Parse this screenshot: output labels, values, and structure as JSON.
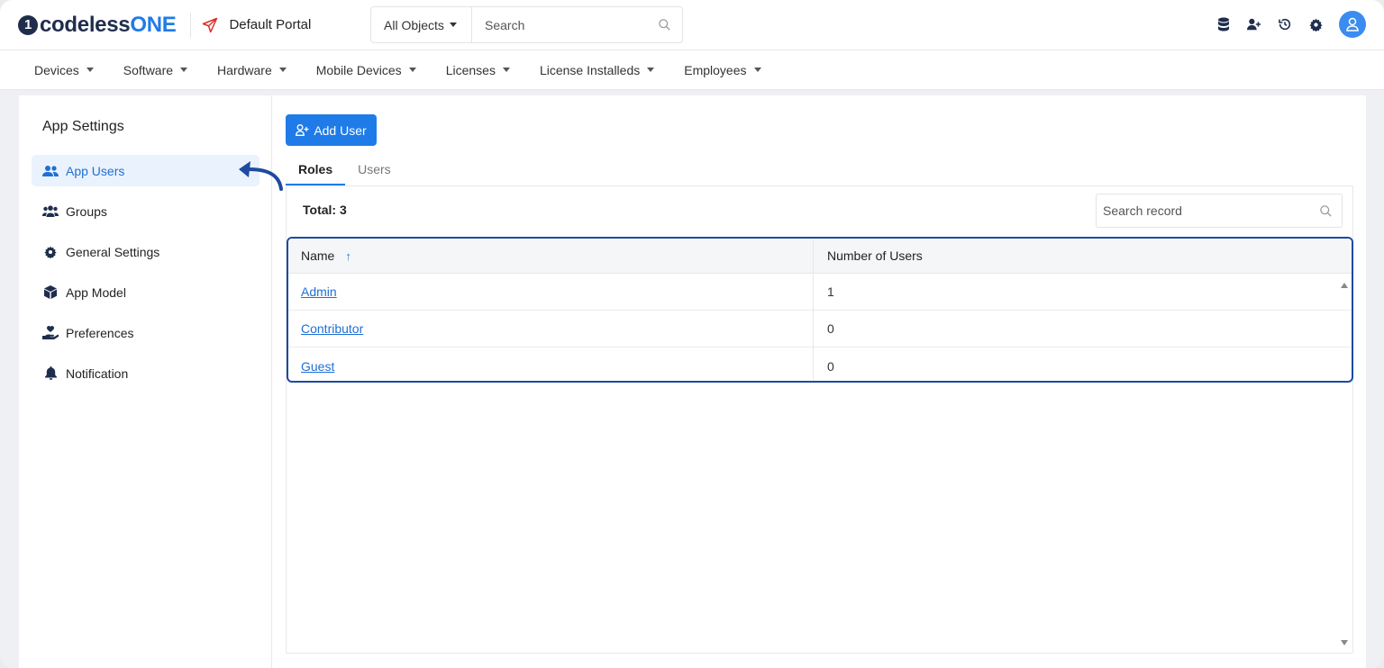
{
  "brand": {
    "logo_main": "codeless",
    "logo_accent": "ONE",
    "accent_color": "#1f7be8"
  },
  "portal": {
    "label": "Default Portal"
  },
  "search": {
    "object_select": "All Objects",
    "placeholder": "Search"
  },
  "top_icons": [
    "database-icon",
    "add-user-icon",
    "history-icon",
    "gear-icon",
    "user-avatar-icon"
  ],
  "nav": {
    "items": [
      {
        "label": "Devices"
      },
      {
        "label": "Software"
      },
      {
        "label": "Hardware"
      },
      {
        "label": "Mobile Devices"
      },
      {
        "label": "Licenses"
      },
      {
        "label": "License Installeds"
      },
      {
        "label": "Employees"
      }
    ]
  },
  "sidebar": {
    "title": "App Settings",
    "items": [
      {
        "label": "App Users",
        "icon": "users-icon",
        "active": true
      },
      {
        "label": "Groups",
        "icon": "groups-icon"
      },
      {
        "label": "General Settings",
        "icon": "gear-icon"
      },
      {
        "label": "App Model",
        "icon": "cube-icon"
      },
      {
        "label": "Preferences",
        "icon": "hand-heart-icon"
      },
      {
        "label": "Notification",
        "icon": "bell-icon"
      }
    ]
  },
  "main": {
    "add_user_label": "Add User",
    "tabs": [
      {
        "label": "Roles",
        "active": true
      },
      {
        "label": "Users"
      }
    ],
    "total_label": "Total: 3",
    "record_search_placeholder": "Search record",
    "table": {
      "columns": [
        "Name",
        "Number of Users"
      ],
      "rows": [
        {
          "name": "Admin",
          "count": "1"
        },
        {
          "name": "Contributor",
          "count": "0"
        },
        {
          "name": "Guest",
          "count": "0"
        }
      ]
    }
  }
}
